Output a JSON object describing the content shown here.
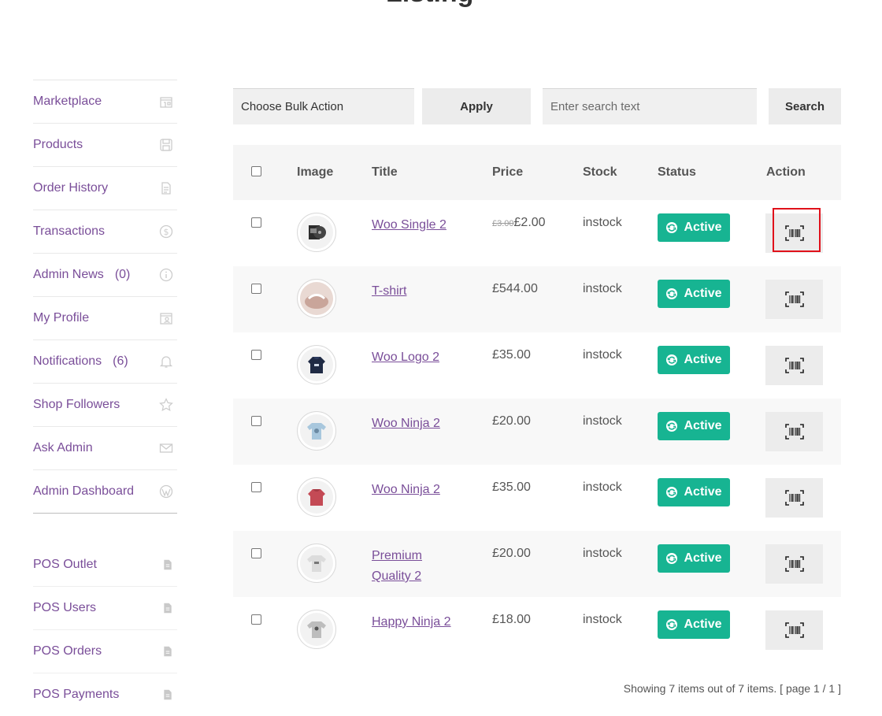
{
  "page_title": "Listing",
  "sidebar": {
    "items": [
      {
        "label": "Marketplace",
        "count": ""
      },
      {
        "label": "Products",
        "count": ""
      },
      {
        "label": "Order History",
        "count": ""
      },
      {
        "label": "Transactions",
        "count": ""
      },
      {
        "label": "Admin News",
        "count": "(0)"
      },
      {
        "label": "My Profile",
        "count": ""
      },
      {
        "label": "Notifications",
        "count": "(6)"
      },
      {
        "label": "Shop Followers",
        "count": ""
      },
      {
        "label": "Ask Admin",
        "count": ""
      },
      {
        "label": "Admin Dashboard",
        "count": ""
      }
    ],
    "pos_items": [
      {
        "label": "POS Outlet"
      },
      {
        "label": "POS Users"
      },
      {
        "label": "POS Orders"
      },
      {
        "label": "POS Payments"
      }
    ]
  },
  "toolbar": {
    "bulk_action_label": "Choose Bulk Action",
    "apply_label": "Apply",
    "search_placeholder": "Enter search text",
    "search_label": "Search"
  },
  "table": {
    "headers": [
      "Image",
      "Title",
      "Price",
      "Stock",
      "Status",
      "Action"
    ],
    "rows": [
      {
        "title": "Woo Single 2",
        "old_price": "£3.00",
        "price": "£2.00",
        "stock": "instock",
        "status": "Active"
      },
      {
        "title": "T-shirt",
        "old_price": "",
        "price": "£544.00",
        "stock": "instock",
        "status": "Active"
      },
      {
        "title": "Woo Logo 2",
        "old_price": "",
        "price": "£35.00",
        "stock": "instock",
        "status": "Active"
      },
      {
        "title": "Woo Ninja 2",
        "old_price": "",
        "price": "£20.00",
        "stock": "instock",
        "status": "Active"
      },
      {
        "title": "Woo Ninja 2",
        "old_price": "",
        "price": "£35.00",
        "stock": "instock",
        "status": "Active"
      },
      {
        "title": "Premium Quality 2",
        "old_price": "",
        "price": "£20.00",
        "stock": "instock",
        "status": "Active"
      },
      {
        "title": "Happy Ninja 2",
        "old_price": "",
        "price": "£18.00",
        "stock": "instock",
        "status": "Active"
      }
    ]
  },
  "pagination_text": "Showing 7 items out of 7 items. [ page 1 / 1 ]",
  "colors": {
    "accent": "#7a4e99",
    "status_active": "#17b492",
    "highlight": "#e0111b"
  }
}
